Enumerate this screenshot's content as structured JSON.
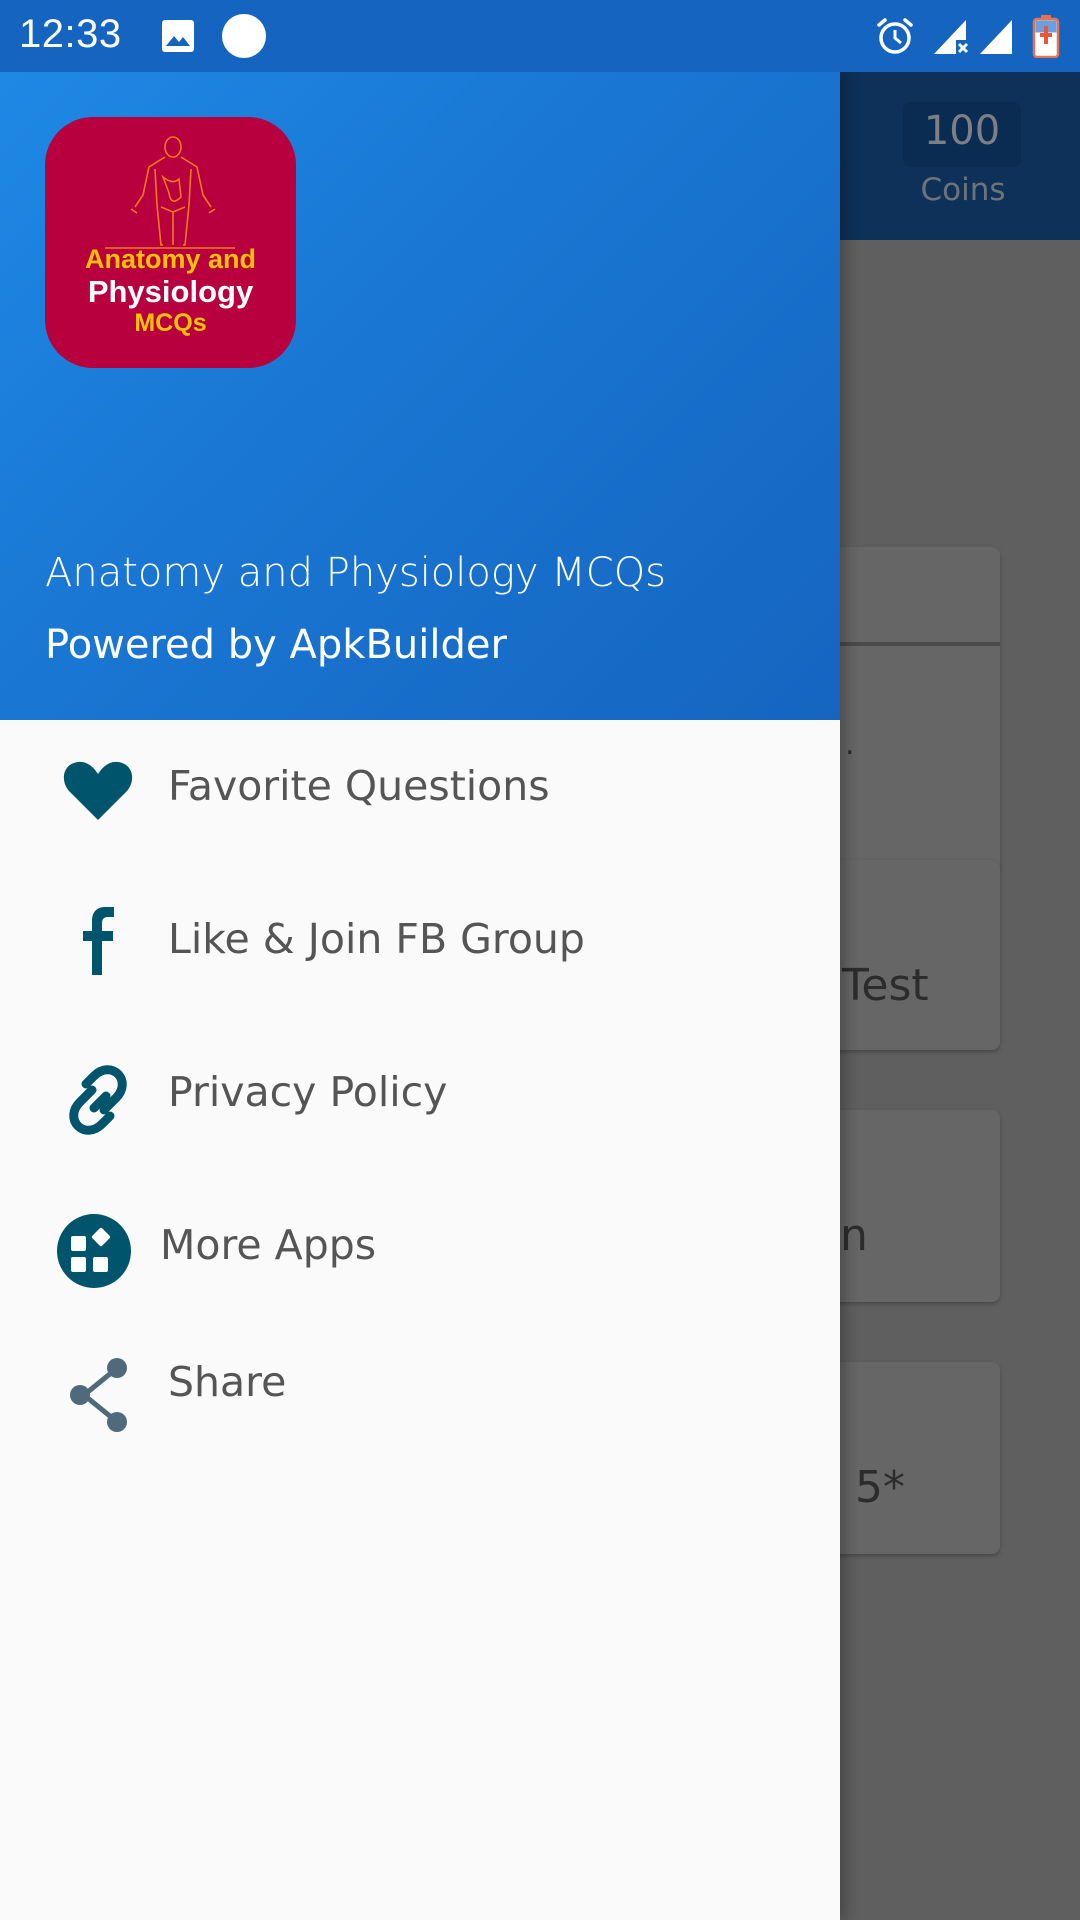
{
  "status_bar": {
    "time": "12:33",
    "left_icons": [
      "gallery-icon",
      "circle-notification-icon"
    ],
    "right_icons": [
      "alarm-icon",
      "signal-no-sim-icon",
      "signal-icon",
      "battery-charging-icon"
    ]
  },
  "drawer": {
    "header": {
      "app_icon_text": {
        "line1": "Anatomy and",
        "line2": "Physiology",
        "line3": "MCQs"
      },
      "title": "Anatomy and Physiology MCQs",
      "subtitle": "Powered by ApkBuilder"
    },
    "items": [
      {
        "label": "Favorite Questions",
        "icon": "heart-icon"
      },
      {
        "label": "Like & Join FB Group",
        "icon": "facebook-icon"
      },
      {
        "label": "Privacy Policy",
        "icon": "link-icon"
      },
      {
        "label": "More Apps",
        "icon": "apps-icon"
      },
      {
        "label": "Share",
        "icon": "share-icon"
      }
    ],
    "colors": {
      "header_start": "#1E88E5",
      "header_end": "#1565C0",
      "icon": "#00546B",
      "text": "#555555"
    }
  },
  "background_app": {
    "coins": {
      "value": "100",
      "label": "Coins"
    },
    "card_fragments": [
      ".",
      "Test",
      "n",
      "5*"
    ]
  }
}
